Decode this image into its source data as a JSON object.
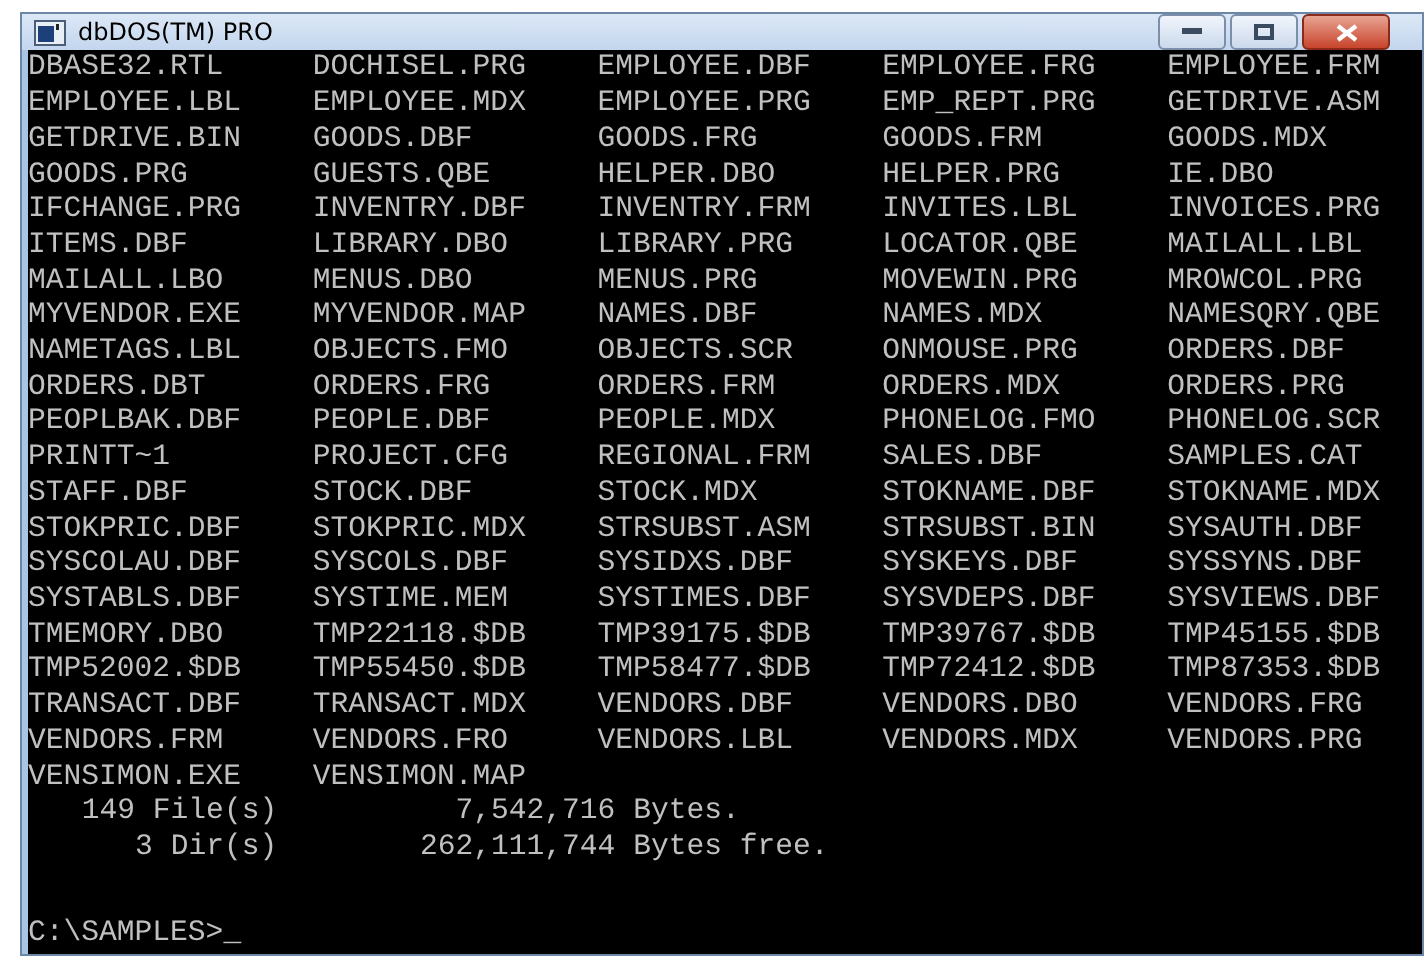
{
  "window": {
    "title": "dbDOS(TM) PRO"
  },
  "files": [
    "DBASE32.RTL",
    "DOCHISEL.PRG",
    "EMPLOYEE.DBF",
    "EMPLOYEE.FRG",
    "EMPLOYEE.FRM",
    "EMPLOYEE.LBL",
    "EMPLOYEE.MDX",
    "EMPLOYEE.PRG",
    "EMP_REPT.PRG",
    "GETDRIVE.ASM",
    "GETDRIVE.BIN",
    "GOODS.DBF",
    "GOODS.FRG",
    "GOODS.FRM",
    "GOODS.MDX",
    "GOODS.PRG",
    "GUESTS.QBE",
    "HELPER.DBO",
    "HELPER.PRG",
    "IE.DBO",
    "IFCHANGE.PRG",
    "INVENTRY.DBF",
    "INVENTRY.FRM",
    "INVITES.LBL",
    "INVOICES.PRG",
    "ITEMS.DBF",
    "LIBRARY.DBO",
    "LIBRARY.PRG",
    "LOCATOR.QBE",
    "MAILALL.LBL",
    "MAILALL.LBO",
    "MENUS.DBO",
    "MENUS.PRG",
    "MOVEWIN.PRG",
    "MROWCOL.PRG",
    "MYVENDOR.EXE",
    "MYVENDOR.MAP",
    "NAMES.DBF",
    "NAMES.MDX",
    "NAMESQRY.QBE",
    "NAMETAGS.LBL",
    "OBJECTS.FMO",
    "OBJECTS.SCR",
    "ONMOUSE.PRG",
    "ORDERS.DBF",
    "ORDERS.DBT",
    "ORDERS.FRG",
    "ORDERS.FRM",
    "ORDERS.MDX",
    "ORDERS.PRG",
    "PEOPLBAK.DBF",
    "PEOPLE.DBF",
    "PEOPLE.MDX",
    "PHONELOG.FMO",
    "PHONELOG.SCR",
    "PRINTT~1",
    "PROJECT.CFG",
    "REGIONAL.FRM",
    "SALES.DBF",
    "SAMPLES.CAT",
    "STAFF.DBF",
    "STOCK.DBF",
    "STOCK.MDX",
    "STOKNAME.DBF",
    "STOKNAME.MDX",
    "STOKPRIC.DBF",
    "STOKPRIC.MDX",
    "STRSUBST.ASM",
    "STRSUBST.BIN",
    "SYSAUTH.DBF",
    "SYSCOLAU.DBF",
    "SYSCOLS.DBF",
    "SYSIDXS.DBF",
    "SYSKEYS.DBF",
    "SYSSYNS.DBF",
    "SYSTABLS.DBF",
    "SYSTIME.MEM",
    "SYSTIMES.DBF",
    "SYSVDEPS.DBF",
    "SYSVIEWS.DBF",
    "TMEMORY.DBO",
    "TMP22118.$DB",
    "TMP39175.$DB",
    "TMP39767.$DB",
    "TMP45155.$DB",
    "TMP52002.$DB",
    "TMP55450.$DB",
    "TMP58477.$DB",
    "TMP72412.$DB",
    "TMP87353.$DB",
    "TRANSACT.DBF",
    "TRANSACT.MDX",
    "VENDORS.DBF",
    "VENDORS.DBO",
    "VENDORS.FRG",
    "VENDORS.FRM",
    "VENDORS.FRO",
    "VENDORS.LBL",
    "VENDORS.MDX",
    "VENDORS.PRG",
    "VENSIMON.EXE",
    "VENSIMON.MAP"
  ],
  "summary": [
    {
      "count": "149",
      "label": "File(s)",
      "size": "7,542,716",
      "unit": "Bytes."
    },
    {
      "count": "3",
      "label": "Dir(s)",
      "size": "262,111,744",
      "unit": "Bytes free."
    }
  ],
  "prompt": {
    "path": "C:\\SAMPLES>",
    "cursor": "_"
  }
}
